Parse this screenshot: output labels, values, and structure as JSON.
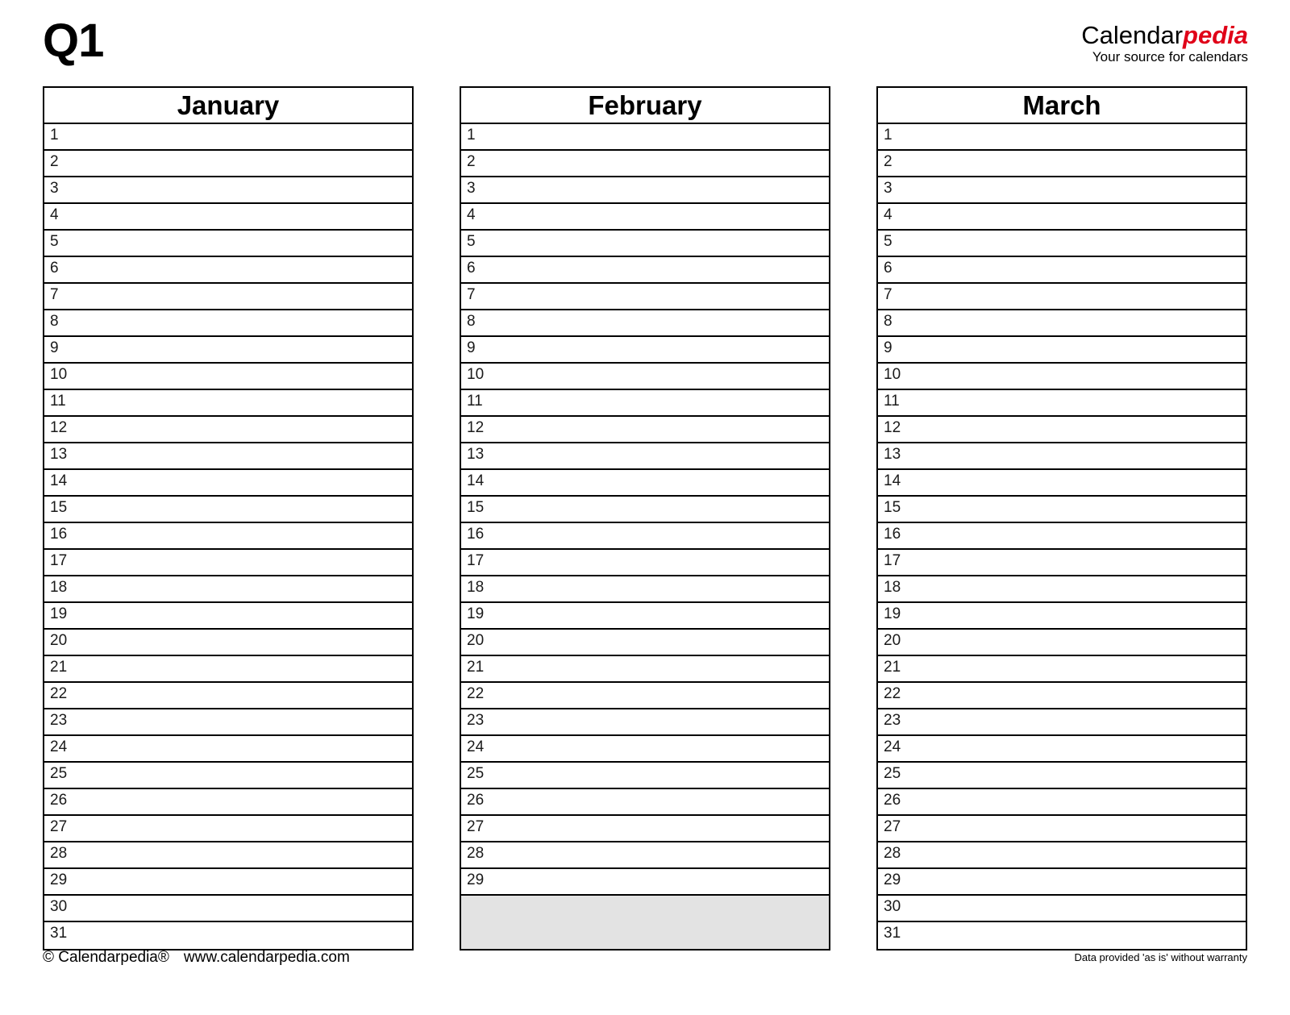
{
  "header": {
    "quarter_title": "Q1",
    "brand_black": "Calendar",
    "brand_red": "pedia",
    "brand_tagline": "Your source for calendars"
  },
  "months": [
    {
      "name": "January",
      "days": [
        "1",
        "2",
        "3",
        "4",
        "5",
        "6",
        "7",
        "8",
        "9",
        "10",
        "11",
        "12",
        "13",
        "14",
        "15",
        "16",
        "17",
        "18",
        "19",
        "20",
        "21",
        "22",
        "23",
        "24",
        "25",
        "26",
        "27",
        "28",
        "29",
        "30",
        "31"
      ],
      "filler_rows": 0
    },
    {
      "name": "February",
      "days": [
        "1",
        "2",
        "3",
        "4",
        "5",
        "6",
        "7",
        "8",
        "9",
        "10",
        "11",
        "12",
        "13",
        "14",
        "15",
        "16",
        "17",
        "18",
        "19",
        "20",
        "21",
        "22",
        "23",
        "24",
        "25",
        "26",
        "27",
        "28",
        "29"
      ],
      "filler_rows": 2
    },
    {
      "name": "March",
      "days": [
        "1",
        "2",
        "3",
        "4",
        "5",
        "6",
        "7",
        "8",
        "9",
        "10",
        "11",
        "12",
        "13",
        "14",
        "15",
        "16",
        "17",
        "18",
        "19",
        "20",
        "21",
        "22",
        "23",
        "24",
        "25",
        "26",
        "27",
        "28",
        "29",
        "30",
        "31"
      ],
      "filler_rows": 0
    }
  ],
  "footer": {
    "copyright": "© Calendarpedia®",
    "website": "www.calendarpedia.com",
    "disclaimer": "Data provided 'as is' without warranty"
  },
  "colors": {
    "brand_red": "#e00018",
    "border": "#000000",
    "filler_gray": "#e3e3e3",
    "background": "#ffffff"
  }
}
